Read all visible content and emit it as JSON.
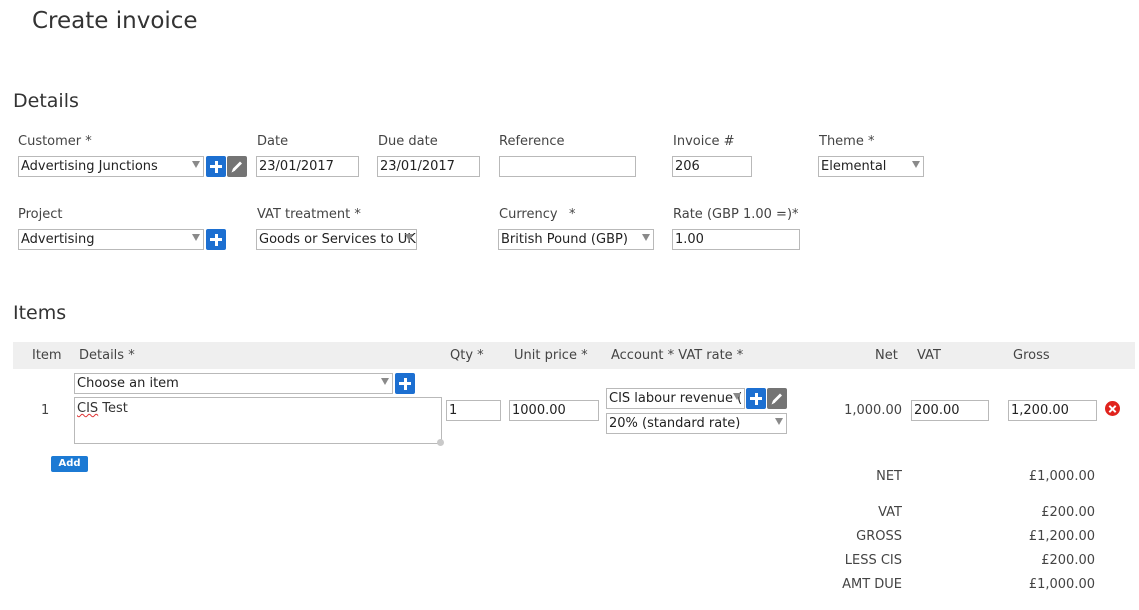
{
  "page": {
    "title": "Create invoice"
  },
  "details": {
    "heading": "Details",
    "customer": {
      "label": "Customer *",
      "value": "Advertising Junctions"
    },
    "date": {
      "label": "Date",
      "value": "23/01/2017"
    },
    "due_date": {
      "label": "Due date",
      "value": "23/01/2017"
    },
    "reference": {
      "label": "Reference",
      "value": ""
    },
    "invoice_no": {
      "label": "Invoice #",
      "value": "206"
    },
    "theme": {
      "label": "Theme *",
      "value": "Elemental"
    },
    "project": {
      "label": "Project",
      "value": "Advertising"
    },
    "vat_treatment": {
      "label": "VAT treatment *",
      "value": "Goods or Services to UK"
    },
    "currency": {
      "label": "Currency",
      "star": "*",
      "value": "British Pound (GBP)"
    },
    "rate": {
      "label": "Rate (GBP 1.00 =)",
      "star": "*",
      "value": "1.00"
    }
  },
  "items": {
    "heading": "Items",
    "columns": {
      "item": "Item",
      "details": "Details *",
      "qty": "Qty *",
      "unit_price": "Unit price *",
      "account_vat": "Account * VAT rate *",
      "net": "Net",
      "vat": "VAT",
      "gross": "Gross"
    },
    "rows": [
      {
        "item": "1",
        "choose_item": "Choose an item",
        "details_first": "CIS",
        "details_rest": " Test",
        "qty": "1",
        "unit_price": "1000.00",
        "account": "CIS labour revenue (",
        "vat_rate": "20% (standard rate)",
        "net": "1,000.00",
        "vat": "200.00",
        "gross": "1,200.00"
      }
    ],
    "add_label": "Add"
  },
  "totals": [
    {
      "label": "NET",
      "value": "£1,000.00"
    },
    {
      "label": "VAT",
      "value": "£200.00"
    },
    {
      "label": "GROSS",
      "value": "£1,200.00"
    },
    {
      "label": "LESS CIS",
      "value": "£200.00"
    },
    {
      "label": "AMT DUE",
      "value": "£1,000.00"
    }
  ],
  "colors": {
    "accent": "#1c6fd1",
    "remove": "#e0231d",
    "header_bg": "#efefef"
  }
}
